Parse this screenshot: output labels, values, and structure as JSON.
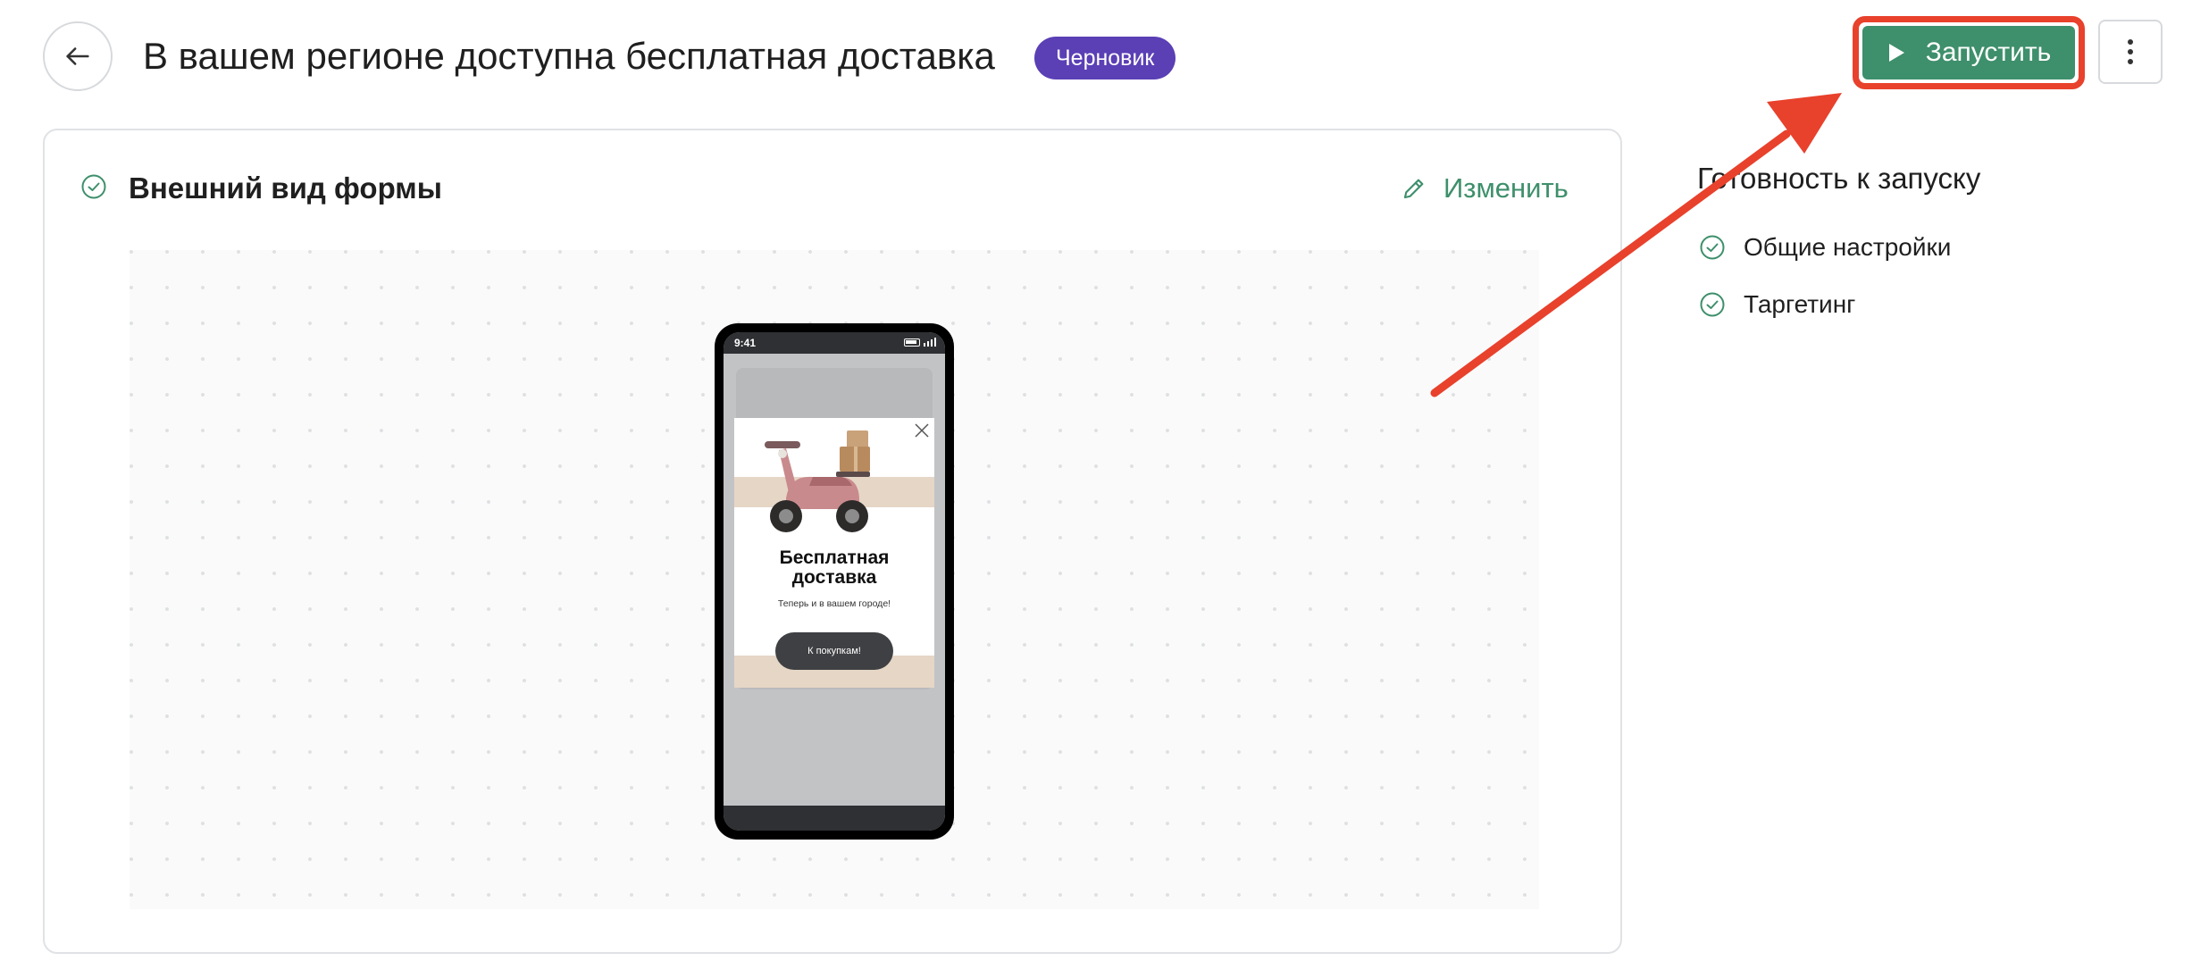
{
  "header": {
    "title": "В вашем регионе доступна бесплатная доставка",
    "status_badge": "Черновик",
    "launch_label": "Запустить"
  },
  "form_card": {
    "title": "Внешний вид формы",
    "edit_label": "Изменить"
  },
  "phone_preview": {
    "status_time": "9:41",
    "popup_title_line1": "Бесплатная",
    "popup_title_line2": "доставка",
    "popup_subtitle": "Теперь и в вашем городе!",
    "popup_button": "К покупкам!"
  },
  "readiness": {
    "title": "Готовность к запуску",
    "items": [
      {
        "label": "Общие настройки"
      },
      {
        "label": "Таргетинг"
      }
    ]
  },
  "colors": {
    "accent_green": "#3e8f6b",
    "badge_purple": "#5a3fb5",
    "annotation_red": "#e8412c"
  }
}
